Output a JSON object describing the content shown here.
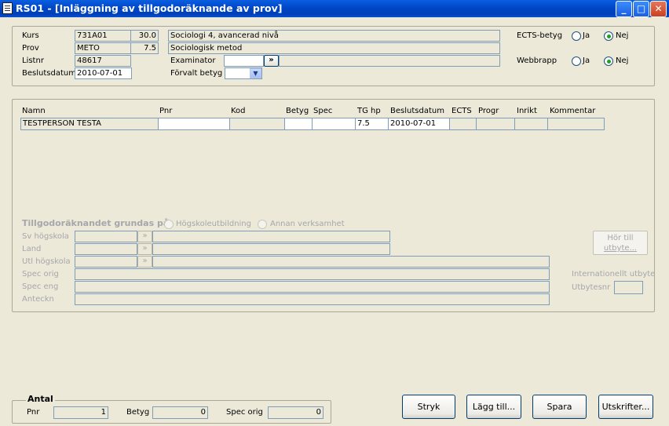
{
  "window": {
    "title": "RS01 - [Inläggning av tillgodoräknande av prov]",
    "min": "_",
    "max": "□",
    "close": "✕"
  },
  "top": {
    "kurs_label": "Kurs",
    "kurs_code": "731A01",
    "kurs_hp": "30.0",
    "kurs_name": "Sociologi 4, avancerad nivå",
    "prov_label": "Prov",
    "prov_code": "METO",
    "prov_hp": "7.5",
    "prov_name": "Sociologisk metod",
    "listnr_label": "Listnr",
    "listnr": "48617",
    "beslutsdatum_label": "Beslutsdatum",
    "beslutsdatum": "2010-07-01",
    "examinator_label": "Examinator",
    "examinator_btn": "»",
    "forvalt_label": "Förvalt betyg",
    "ects_label": "ECTS-betyg",
    "webbrapp_label": "Webbrapp",
    "ja": "Ja",
    "nej": "Nej"
  },
  "grid": {
    "headers": [
      "Namn",
      "Pnr",
      "Kod",
      "Betyg",
      "Spec",
      "TG hp",
      "Beslutsdatum",
      "ECTS",
      "Progr",
      "Inrikt",
      "Kommentar"
    ],
    "row": {
      "namn": "TESTPERSON TESTA",
      "pnr": "",
      "kod": "",
      "betyg": "",
      "spec": "",
      "tghp": "7.5",
      "beslutsdatum": "2010-07-01",
      "ects": "",
      "progr": "",
      "inrikt": "",
      "kommentar": ""
    }
  },
  "detail": {
    "grundas_label": "Tillgodoräknandet grundas på",
    "hogskole": "Högskoleutbildning",
    "annan": "Annan verksamhet",
    "sv_hogskola": "Sv högskola",
    "land": "Land",
    "utl_hogskola": "Utl högskola",
    "spec_orig": "Spec orig",
    "spec_eng": "Spec eng",
    "anteckn": "Anteckn",
    "hor_till_1": "Hör till",
    "hor_till_2": "utbyte...",
    "internationellt": "Internationellt utbyte",
    "utbytesnr": "Utbytesnr",
    "lookup_btn": "»"
  },
  "antal": {
    "title": "Antal",
    "pnr_label": "Pnr",
    "pnr": "1",
    "betyg_label": "Betyg",
    "betyg": "0",
    "spec_orig_label": "Spec orig",
    "spec_orig": "0"
  },
  "buttons": {
    "stryk": "Stryk",
    "lagg_till": "Lägg till...",
    "spara": "Spara",
    "utskrifter": "Utskrifter..."
  }
}
